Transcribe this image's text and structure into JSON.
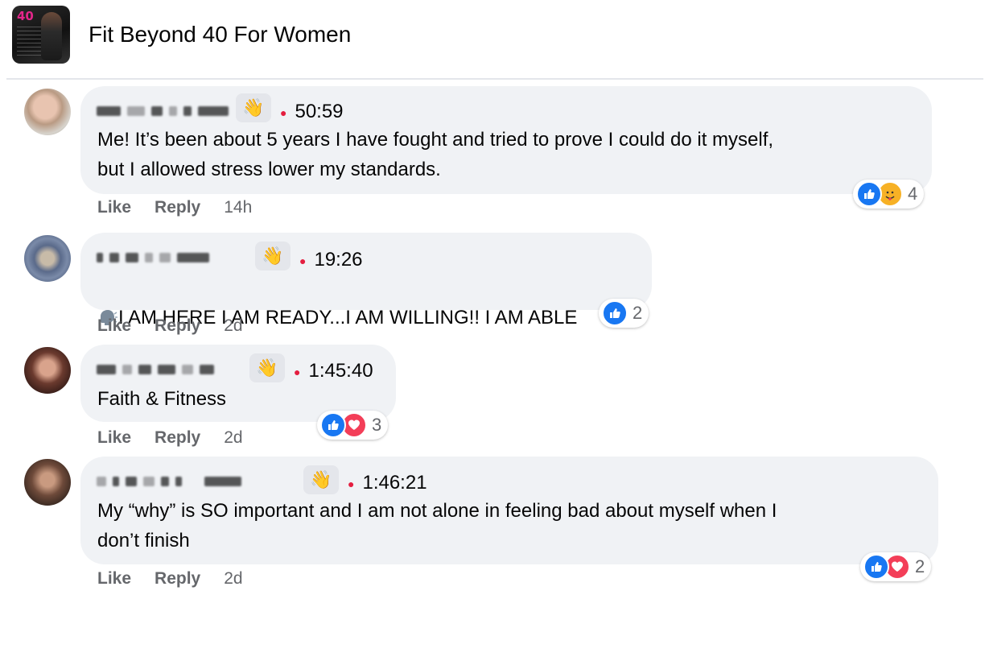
{
  "group": {
    "name": "Fit Beyond 40 For Women",
    "avatar_badge": "40"
  },
  "colors": {
    "bubble": "#f0f2f5",
    "like": "#1877f2",
    "love": "#f33e58",
    "care": "#f7b125",
    "meta": "#65676b"
  },
  "comments": [
    {
      "time": "50:59",
      "text": "Me! It’s been about 5 years I have fought and tried to prove I could do it myself,\nbut I allowed stress lower my standards.",
      "like_label": "Like",
      "reply_label": "Reply",
      "age": "14h",
      "reactions": [
        "like",
        "care"
      ],
      "reaction_count": "4",
      "badge_icon": "wave-icon"
    },
    {
      "time": "19:26",
      "text": "I AM HERE I AM READY...I AM WILLING!! I AM ABLE",
      "leading_emoji": "speaking-head-icon",
      "like_label": "Like",
      "reply_label": "Reply",
      "age": "2d",
      "reactions": [
        "like"
      ],
      "reaction_count": "2",
      "badge_icon": "wave-icon"
    },
    {
      "time": "1:45:40",
      "text": "Faith & Fitness",
      "like_label": "Like",
      "reply_label": "Reply",
      "age": "2d",
      "reactions": [
        "like",
        "love"
      ],
      "reaction_count": "3",
      "badge_icon": "wave-icon"
    },
    {
      "time": "1:46:21",
      "text": "My “why” is SO important and I am not alone in feeling bad about myself when I\ndon’t finish",
      "like_label": "Like",
      "reply_label": "Reply",
      "age": "2d",
      "reactions": [
        "like",
        "love"
      ],
      "reaction_count": "2",
      "badge_icon": "wave-icon"
    }
  ]
}
